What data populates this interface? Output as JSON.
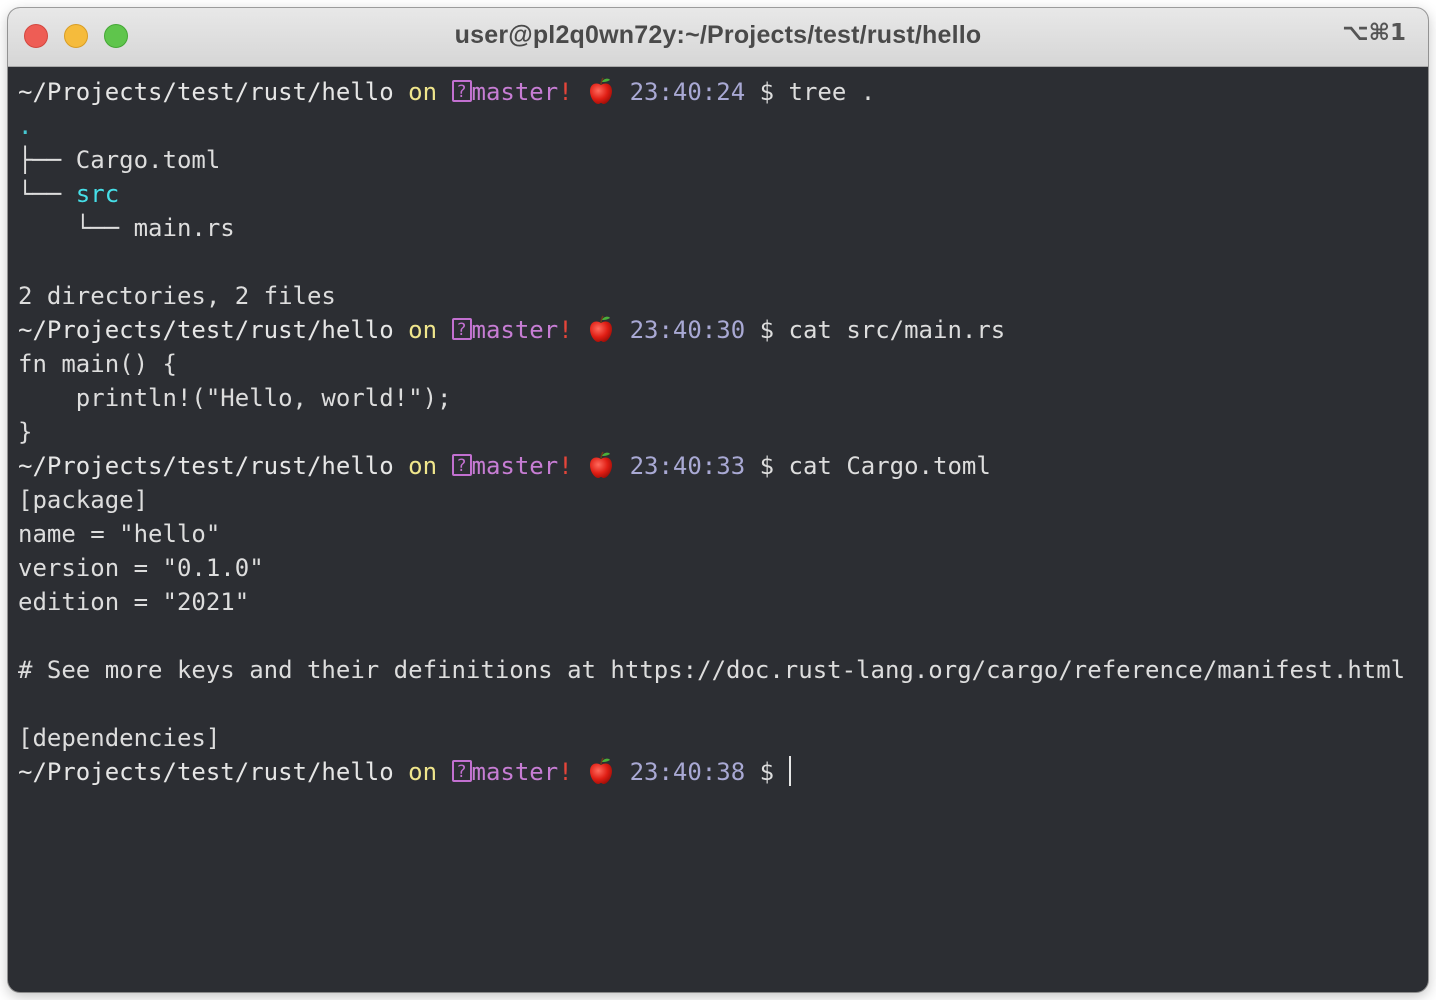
{
  "window": {
    "title": "user@pl2q0wn72y:~/Projects/test/rust/hello",
    "shortcut": "⌥⌘1"
  },
  "prompt": {
    "path": "~/Projects/test/rust/hello",
    "on": "on",
    "branch_icon": "?",
    "branch": "master",
    "dirty": "!",
    "icon": "apple-icon",
    "dollar": "$"
  },
  "colors": {
    "background": "#2c2e33",
    "on": "#f0e68c",
    "branch": "#c77dd4",
    "dirty": "#e5453a",
    "time": "#a9a9d4",
    "directory": "#46dfe8"
  },
  "commands": [
    {
      "time": "23:40:24",
      "command": "tree ."
    },
    {
      "time": "23:40:30",
      "command": "cat src/main.rs"
    },
    {
      "time": "23:40:33",
      "command": "cat Cargo.toml"
    },
    {
      "time": "23:40:38",
      "command": ""
    }
  ],
  "tree": {
    "root": ".",
    "l1_branch": "├── ",
    "l1_file": "Cargo.toml",
    "l2_branch": "└── ",
    "l2_dir": "src",
    "l3_prefix": "    └── ",
    "l3_file": "main.rs",
    "summary": "2 directories, 2 files"
  },
  "main_rs": [
    "fn main() {",
    "    println!(\"Hello, world!\");",
    "}"
  ],
  "cargo_toml": [
    "[package]",
    "name = \"hello\"",
    "version = \"0.1.0\"",
    "edition = \"2021\"",
    "",
    "# See more keys and their definitions at https://doc.rust-lang.org/cargo/reference/manifest.html",
    "",
    "[dependencies]"
  ]
}
